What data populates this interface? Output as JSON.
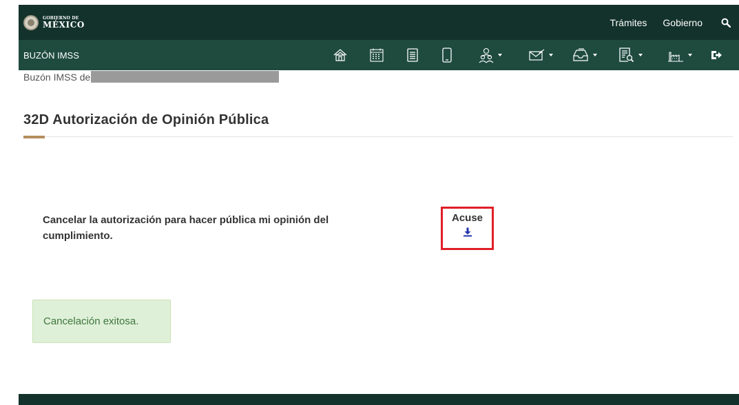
{
  "gov_header": {
    "logo_small": "GOBIERNO DE",
    "logo_large": "MÉXICO",
    "nav": [
      "Trámites",
      "Gobierno"
    ],
    "search_icon": "search-icon",
    "background": "#13322b"
  },
  "sub_header": {
    "title": "BUZÓN IMSS",
    "background": "#1f4b3f",
    "tools": [
      {
        "name": "home-icon",
        "dropdown": false
      },
      {
        "name": "calendar-icon",
        "dropdown": false
      },
      {
        "name": "document-icon",
        "dropdown": false
      },
      {
        "name": "mobile-icon",
        "dropdown": false
      },
      {
        "name": "users-icon",
        "dropdown": true
      },
      {
        "name": "mail-icon",
        "dropdown": true
      },
      {
        "name": "inbox-icon",
        "dropdown": true
      },
      {
        "name": "document-search-icon",
        "dropdown": true
      },
      {
        "name": "factory-icon",
        "dropdown": true
      },
      {
        "name": "logout-icon",
        "dropdown": false
      }
    ]
  },
  "breadcrumb": {
    "text": "Buzón IMSS de"
  },
  "page": {
    "title": "32D Autorización de Opinión Pública",
    "accent_color": "#b38e5d",
    "cancel_text": "Cancelar la autorización para hacer pública mi opinión del cumplimiento.",
    "acuse_label": "Acuse",
    "acuse_highlight_color": "#e01f26",
    "download_icon": "download-icon",
    "alert_text": "Cancelación exitosa.",
    "alert_color": "#3c763d"
  }
}
